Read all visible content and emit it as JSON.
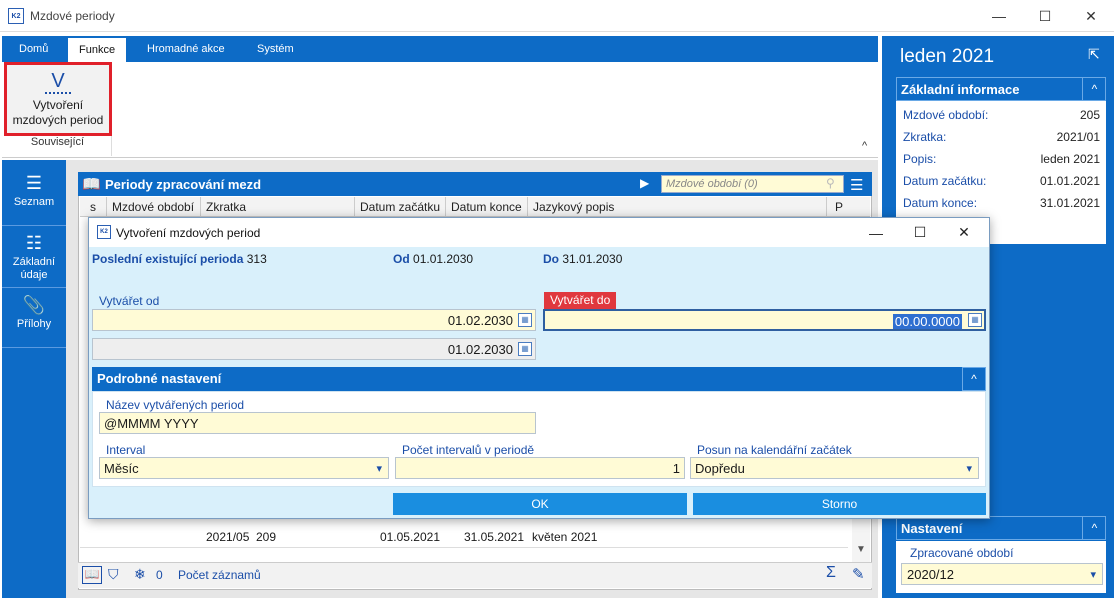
{
  "window": {
    "title": "Mzdové periody",
    "logo": "K2",
    "minimize": "—",
    "maximize": "☐",
    "close": "✕"
  },
  "ribbon": {
    "tabs": [
      "Domů",
      "Funkce",
      "Hromadné akce",
      "Systém"
    ],
    "active_tab": "Funkce",
    "create_button": {
      "icon": "V",
      "label_line1": "Vytvoření",
      "label_line2": "mzdových period"
    },
    "group_label": "Související",
    "collapse": "^"
  },
  "leftnav": {
    "items": [
      {
        "icon": "☰",
        "label": "Seznam"
      },
      {
        "icon": "☷",
        "label": "Základní údaje"
      },
      {
        "icon": "📎",
        "label": "Přílohy"
      }
    ]
  },
  "grid": {
    "title": "Periody zpracování mezd",
    "search_placeholder": "Mzdové období (0)",
    "columns": [
      "s",
      "Mzdové období",
      "Zkratka",
      "Datum začátku",
      "Datum konce",
      "Jazykový popis",
      "P"
    ],
    "rows": [
      {
        "obdobi": "209",
        "zkratka": "2021/05",
        "zacatek": "01.05.2021",
        "konec": "31.05.2021",
        "popis": "květen 2021"
      }
    ],
    "footer": {
      "count": "0",
      "label": "Počet záznamů",
      "sum_icon": "Σ",
      "edit_icon": "✎"
    }
  },
  "rightpanel": {
    "title": "leden 2021",
    "info_header": "Základní informace",
    "info": [
      {
        "label": "Mzdové období:",
        "value": "205"
      },
      {
        "label": "Zkratka:",
        "value": "2021/01"
      },
      {
        "label": "Popis:",
        "value": "leden 2021"
      },
      {
        "label": "Datum začátku:",
        "value": "01.01.2021"
      },
      {
        "label": "Datum konce:",
        "value": "31.01.2021"
      }
    ],
    "settings_header": "Nastavení",
    "settings_label": "Zpracované období",
    "settings_value": "2020/12"
  },
  "dialog": {
    "title": "Vytvoření mzdových period",
    "logo": "K2",
    "last_label": "Poslední existující perioda",
    "last_value": "313",
    "od_label": "Od",
    "od_value": "01.01.2030",
    "do_label": "Do",
    "do_value": "31.01.2030",
    "from_label": "Vytvářet od",
    "from_value": "01.02.2030",
    "from_ro_value": "01.02.2030",
    "to_label": "Vytvářet do",
    "to_value": "00.00.0000",
    "section_title": "Podrobné nastavení",
    "name_label": "Název vytvářených period",
    "name_value": "@MMMM YYYY",
    "interval_label": "Interval",
    "interval_value": "Měsíc",
    "count_label": "Počet intervalů v periodě",
    "count_value": "1",
    "shift_label": "Posun na kalendářní začátek",
    "shift_value": "Dopředu",
    "ok": "OK",
    "cancel": "Storno"
  },
  "colors": {
    "accent": "#0d6bc6",
    "highlight_red": "#e0202a",
    "field_yellow": "#fffbd6"
  }
}
